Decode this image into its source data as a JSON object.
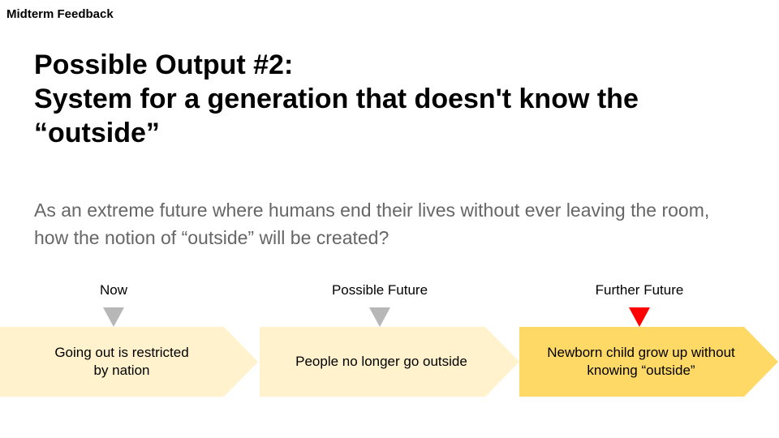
{
  "header": {
    "label": "Midterm Feedback"
  },
  "title": {
    "line1": "Possible Output #2:",
    "line2": "System for a generation that doesn't know the",
    "line3": "“outside”"
  },
  "subtitle": {
    "line1": "As an extreme future where humans end their lives without ever leaving the room,",
    "line2": "how the notion of “outside” will be created?"
  },
  "timeline": {
    "stages": [
      {
        "label": "Now",
        "text_line1": "Going out is restricted",
        "text_line2": "by nation",
        "marker": "triangle-down-icon",
        "fill": "#fff2cc"
      },
      {
        "label": "Possible Future",
        "text_line1": "People no longer go outside",
        "text_line2": "",
        "marker": "triangle-down-icon",
        "fill": "#fff2cc"
      },
      {
        "label": "Further Future",
        "text_line1": "Newborn child grow up without",
        "text_line2": "knowing “outside”",
        "marker": "triangle-down-icon",
        "fill": "#ffd966",
        "active": true
      }
    ],
    "colors": {
      "marker_inactive": "#b7b7b7",
      "marker_active": "#ff0000"
    }
  }
}
